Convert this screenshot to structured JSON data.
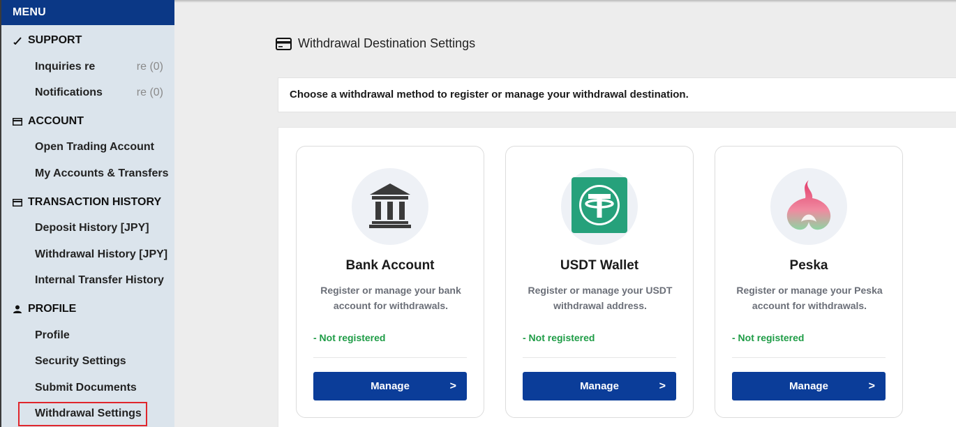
{
  "sidebar": {
    "menu_label": "MENU",
    "sections": [
      {
        "title": "SUPPORT",
        "icon": "check-icon"
      },
      {
        "title": "ACCOUNT",
        "icon": "card-icon"
      },
      {
        "title": "TRANSACTION HISTORY",
        "icon": "card-icon"
      },
      {
        "title": "PROFILE",
        "icon": "person-icon"
      }
    ],
    "items": [
      {
        "label": "Inquiries re",
        "count": "re (0)"
      },
      {
        "label": "Notifications",
        "count": "re (0)"
      },
      {
        "label": "Open Trading Account"
      },
      {
        "label": "My Accounts & Transfers"
      },
      {
        "label": "Deposit History [JPY]"
      },
      {
        "label": "Withdrawal History [JPY]"
      },
      {
        "label": "Internal Transfer History"
      },
      {
        "label": "Profile"
      },
      {
        "label": "Security Settings"
      },
      {
        "label": "Submit Documents"
      },
      {
        "label": "Withdrawal Settings",
        "active": true
      }
    ]
  },
  "main": {
    "title": "Withdrawal Destination Settings",
    "instruction": "Choose a withdrawal method to register or manage your withdrawal destination.",
    "cards": [
      {
        "title": "Bank Account",
        "desc": "Register or manage your bank account for withdrawals.",
        "status": "- Not registered",
        "button": "Manage",
        "chevron": ">",
        "icon": "bank-icon"
      },
      {
        "title": "USDT Wallet",
        "desc": "Register or manage your USDT withdrawal address.",
        "status": "- Not registered",
        "button": "Manage",
        "chevron": ">",
        "icon": "usdt-icon"
      },
      {
        "title": "Peska",
        "desc": "Register or manage your Peska account for withdrawals.",
        "status": "- Not registered",
        "button": "Manage",
        "chevron": ">",
        "icon": "peska-icon"
      }
    ]
  },
  "colors": {
    "menu_header": "#0b3886",
    "button": "#0b3d99",
    "status": "#1e9c46",
    "highlight": "#e0262c",
    "usdt": "#26a17b"
  }
}
